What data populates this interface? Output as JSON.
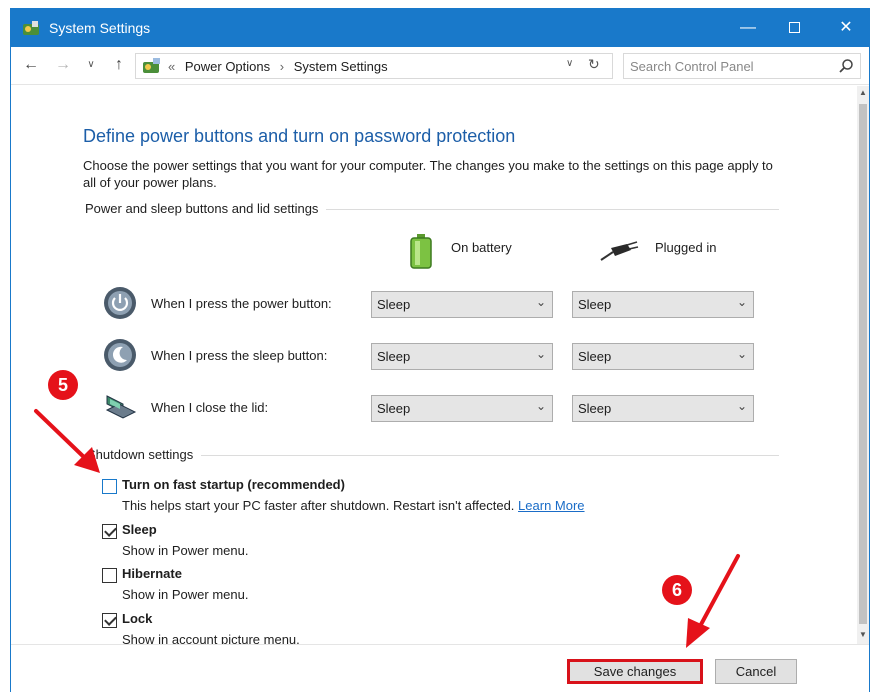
{
  "window": {
    "title": "System Settings",
    "controls": {
      "minimize": "—",
      "close": "✕"
    }
  },
  "navigation": {
    "back": "←",
    "forward": "→",
    "recent": "∨",
    "up": "↑",
    "breadcrumb": {
      "overflow": "«",
      "items": [
        "Power Options",
        "System Settings"
      ],
      "separator": "›",
      "dropdown": "∨",
      "refresh": "↻"
    },
    "search": {
      "placeholder": "Search Control Panel"
    }
  },
  "page": {
    "heading": "Define power buttons and turn on password protection",
    "description": "Choose the power settings that you want for your computer. The changes you make to the settings on this page apply to all of your power plans."
  },
  "power_section": {
    "label": "Power and sleep buttons and lid settings",
    "columns": [
      "On battery",
      "Plugged in"
    ],
    "rows": [
      {
        "label": "When I press the power button:",
        "on_battery": "Sleep",
        "plugged_in": "Sleep"
      },
      {
        "label": "When I press the sleep button:",
        "on_battery": "Sleep",
        "plugged_in": "Sleep"
      },
      {
        "label": "When I close the lid:",
        "on_battery": "Sleep",
        "plugged_in": "Sleep"
      }
    ]
  },
  "shutdown_section": {
    "label": "Shutdown settings",
    "options": [
      {
        "title": "Turn on fast startup (recommended)",
        "subtitle": "This helps start your PC faster after shutdown. Restart isn't affected.",
        "link": "Learn More",
        "checked": false
      },
      {
        "title": "Sleep",
        "subtitle": "Show in Power menu.",
        "checked": true
      },
      {
        "title": "Hibernate",
        "subtitle": "Show in Power menu.",
        "checked": false
      },
      {
        "title": "Lock",
        "subtitle": "Show in account picture menu.",
        "checked": true
      }
    ]
  },
  "buttons": {
    "save": "Save changes",
    "cancel": "Cancel"
  },
  "annotations": {
    "step_5": "5",
    "step_6": "6",
    "color": "#e5121a"
  },
  "colors": {
    "titlebar": "#1979ca",
    "heading": "#1c5ea8",
    "link": "#1a6cc7"
  },
  "icons": {
    "app": "control-panel-icon",
    "battery": "battery-icon",
    "plug": "plug-icon",
    "power": "power-button-icon",
    "sleep": "moon-icon",
    "lid": "laptop-lid-icon",
    "search": "magnifier-icon"
  }
}
